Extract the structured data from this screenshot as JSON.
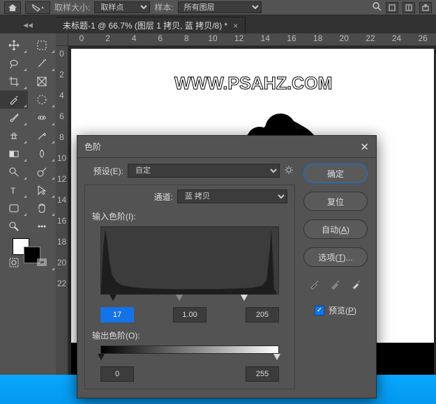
{
  "options_bar": {
    "sample_size_label": "取样大小:",
    "sample_size_value": "取样点",
    "sample_label": "样本:",
    "sample_value": "所有图层"
  },
  "document": {
    "tab_title": "未标题-1 @ 66.7% (图层 1 拷贝, 蓝 拷贝/8) *",
    "zoom": "66.67"
  },
  "ruler_h": [
    "0",
    "2",
    "4",
    "6",
    "8",
    "10",
    "12",
    "14",
    "16",
    "18",
    "20",
    "22",
    "24",
    "26"
  ],
  "ruler_v": [
    "0",
    "2",
    "4",
    "6",
    "8",
    "10",
    "12",
    "14",
    "16",
    "18",
    "20",
    "22"
  ],
  "watermark": "WWW.PSAHZ.COM",
  "dialog": {
    "title": "色阶",
    "preset_label": "预设(E):",
    "preset_value": "自定",
    "channel_label": "通道:",
    "channel_value": "蓝 拷贝",
    "input_label": "输入色阶(I):",
    "output_label": "输出色阶(O):",
    "input_black": "17",
    "input_gamma": "1.00",
    "input_white": "205",
    "output_black": "0",
    "output_white": "255",
    "ok": "确定",
    "reset": "复位",
    "auto": "自动(A)",
    "options": "选项(T)...",
    "preview": "预览(P)"
  }
}
